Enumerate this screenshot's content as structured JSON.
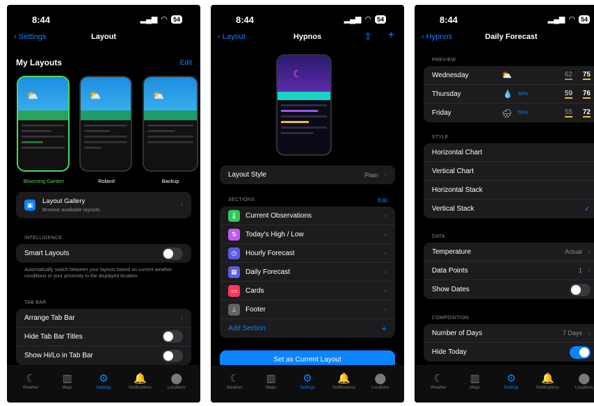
{
  "status": {
    "time": "8:44",
    "battery": "54"
  },
  "tabs": [
    {
      "label": "Weather",
      "icon": "moon-icon",
      "glyph": "☾"
    },
    {
      "label": "Maps",
      "icon": "map-icon",
      "glyph": "▥"
    },
    {
      "label": "Settings",
      "icon": "gear-icon",
      "glyph": "⚙"
    },
    {
      "label": "Notifications",
      "icon": "bell-icon",
      "glyph": "🔔"
    },
    {
      "label": "Locations",
      "icon": "pin-icon",
      "glyph": "⬤"
    }
  ],
  "screen1": {
    "back": "Settings",
    "title": "Layout",
    "my_layouts": "My Layouts",
    "edit": "Edit",
    "layouts": [
      "Blooming Garden",
      "Roland",
      "Backup"
    ],
    "gallery_title": "Layout Gallery",
    "gallery_sub": "Browse available layouts",
    "intel_header": "INTELLIGENCE",
    "smart_layouts": "Smart Layouts",
    "smart_desc": "Automatically switch between your layouts based on current weather conditions or your proximity to the displayed location.",
    "tabbar_header": "TAB BAR",
    "arrange": "Arrange Tab Bar",
    "hide_titles": "Hide Tab Bar Titles",
    "show_hilo": "Show Hi/Lo in Tab Bar"
  },
  "screen2": {
    "back": "Layout",
    "title": "Hypnos",
    "layout_style": "Layout Style",
    "layout_style_val": "Plain",
    "sections_header": "SECTIONS",
    "edit": "Edit",
    "sections": [
      {
        "label": "Current Observations",
        "color": "#34c759",
        "icon": "thermometer-icon",
        "glyph": "🌡"
      },
      {
        "label": "Today's High / Low",
        "color": "#bf5af2",
        "icon": "arrows-updown-icon",
        "glyph": "⇅"
      },
      {
        "label": "Hourly Forecast",
        "color": "#5e5ce6",
        "icon": "clock-icon",
        "glyph": "◷"
      },
      {
        "label": "Daily Forecast",
        "color": "#5e5ce6",
        "icon": "calendar-icon",
        "glyph": "▦"
      },
      {
        "label": "Cards",
        "color": "#ff375f",
        "icon": "cards-icon",
        "glyph": "▭"
      },
      {
        "label": "Footer",
        "color": "#636366",
        "icon": "footer-icon",
        "glyph": "⊥"
      }
    ],
    "add_section": "Add Section",
    "set_current": "Set as Current Layout"
  },
  "screen3": {
    "back": "Hypnos",
    "title": "Daily Forecast",
    "preview_header": "PREVIEW",
    "preview": [
      {
        "day": "Wednesday",
        "pct": "",
        "lo": "62",
        "hi": "75",
        "icon": "sun-cloud-icon"
      },
      {
        "day": "Thursday",
        "pct": "80%",
        "lo": "59",
        "hi": "76",
        "icon": "raindrop-icon"
      },
      {
        "day": "Friday",
        "pct": "55%",
        "lo": "55",
        "hi": "72",
        "icon": "rain-cloud-icon"
      }
    ],
    "style_header": "STYLE",
    "styles": [
      "Horizontal Chart",
      "Vertical Chart",
      "Horizontal Stack",
      "Vertical Stack"
    ],
    "data_header": "DATA",
    "temperature": "Temperature",
    "temperature_val": "Actual",
    "data_points": "Data Points",
    "data_points_val": "1",
    "show_dates": "Show Dates",
    "composition_header": "COMPOSITION",
    "num_days": "Number of Days",
    "num_days_val": "7 Days",
    "hide_today": "Hide Today"
  }
}
